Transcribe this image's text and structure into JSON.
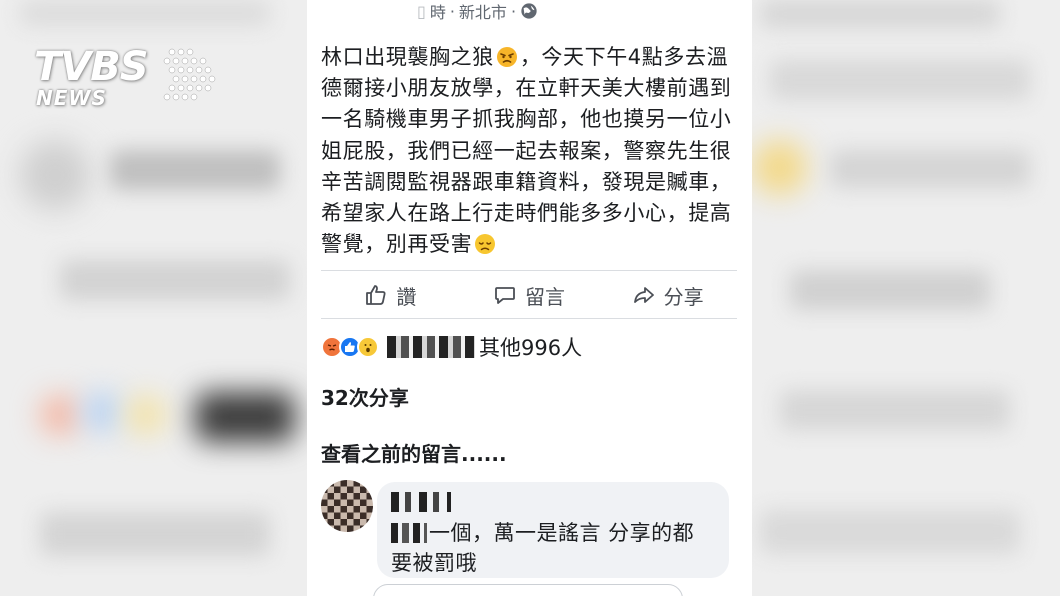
{
  "watermark": {
    "brand": "TVBS",
    "sub": "NEWS"
  },
  "post": {
    "meta_time_fragment": "時",
    "meta_separator": "·",
    "meta_location": "新北市",
    "meta_separator2": "·",
    "privacy_icon": "globe-icon",
    "text_part1": "林口出現襲胸之狼",
    "emoji1": "angry-face-icon",
    "text_part2": "，今天下午4點多去溫德爾接小朋友放學，在立軒天美大樓前遇到一名騎機車男子抓我胸部，他也摸另一位小姐屁股，我們已經一起去報案，警察先生很辛苦調閱監視器跟車籍資料，發現是贓車，希望家人在路上行走時們能多多小心，提高警覺，別再受害",
    "emoji2": "disappointed-face-icon"
  },
  "actions": {
    "like_label": "讚",
    "comment_label": "留言",
    "share_label": "分享"
  },
  "reactions": {
    "icons": [
      "angry-reaction-icon",
      "like-reaction-icon",
      "wow-reaction-icon"
    ],
    "summary": "其他996人"
  },
  "shares_text": "32次分享",
  "view_previous": "查看之前的留言......",
  "comment": {
    "text_after_redaction": "一個，萬一是謠言 分享的都要被罰哦"
  },
  "colors": {
    "facebook_blue": "#1877f2",
    "text": "#1c1e21",
    "secondary_text": "#606770",
    "bubble_bg": "#f0f2f5"
  }
}
